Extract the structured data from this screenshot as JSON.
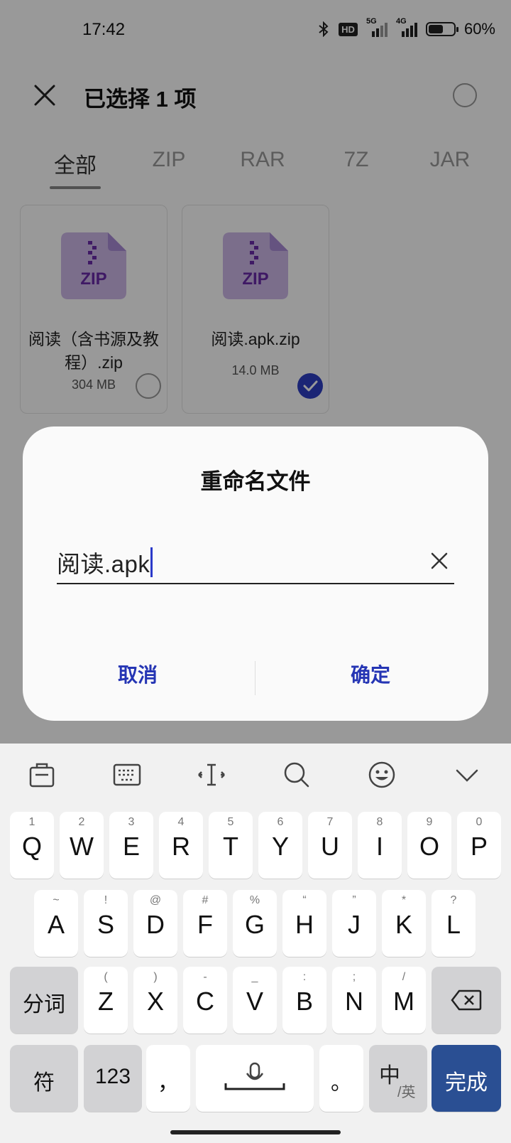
{
  "status_bar": {
    "time": "17:42",
    "hd_label": "HD",
    "net1": "5G",
    "net2": "4G",
    "battery_percent": "60%",
    "battery_level": 0.6
  },
  "header": {
    "title": "已选择 1 项"
  },
  "tabs": [
    {
      "label": "全部",
      "active": true
    },
    {
      "label": "ZIP"
    },
    {
      "label": "RAR"
    },
    {
      "label": "7Z"
    },
    {
      "label": "JAR"
    }
  ],
  "files": [
    {
      "icon_label": "ZIP",
      "name": "阅读（含书源及教程）.zip",
      "size": "304 MB",
      "selected": false
    },
    {
      "icon_label": "ZIP",
      "name": "阅读.apk.zip",
      "size": "14.0 MB",
      "selected": true
    }
  ],
  "dialog": {
    "title": "重命名文件",
    "input_value": "阅读.apk",
    "cancel": "取消",
    "confirm": "确定"
  },
  "keyboard": {
    "row1": [
      {
        "k": "Q",
        "s": "1"
      },
      {
        "k": "W",
        "s": "2"
      },
      {
        "k": "E",
        "s": "3"
      },
      {
        "k": "R",
        "s": "4"
      },
      {
        "k": "T",
        "s": "5"
      },
      {
        "k": "Y",
        "s": "6"
      },
      {
        "k": "U",
        "s": "7"
      },
      {
        "k": "I",
        "s": "8"
      },
      {
        "k": "O",
        "s": "9"
      },
      {
        "k": "P",
        "s": "0"
      }
    ],
    "row2": [
      {
        "k": "A",
        "s": "~"
      },
      {
        "k": "S",
        "s": "!"
      },
      {
        "k": "D",
        "s": "@"
      },
      {
        "k": "F",
        "s": "#"
      },
      {
        "k": "G",
        "s": "%"
      },
      {
        "k": "H",
        "s": "“"
      },
      {
        "k": "J",
        "s": "”"
      },
      {
        "k": "K",
        "s": "*"
      },
      {
        "k": "L",
        "s": "?"
      }
    ],
    "row3": [
      {
        "k": "Z",
        "s": "("
      },
      {
        "k": "X",
        "s": ")"
      },
      {
        "k": "C",
        "s": "-"
      },
      {
        "k": "V",
        "s": "_"
      },
      {
        "k": "B",
        "s": ":"
      },
      {
        "k": "N",
        "s": ";"
      },
      {
        "k": "M",
        "s": "/"
      }
    ],
    "segment_label": "分词",
    "symbol_label": "符",
    "num_label": "123",
    "comma": "，",
    "period": "。",
    "lang_main": "中",
    "lang_sub": "/英",
    "done_label": "完成",
    "accent": "#2a4f93"
  }
}
